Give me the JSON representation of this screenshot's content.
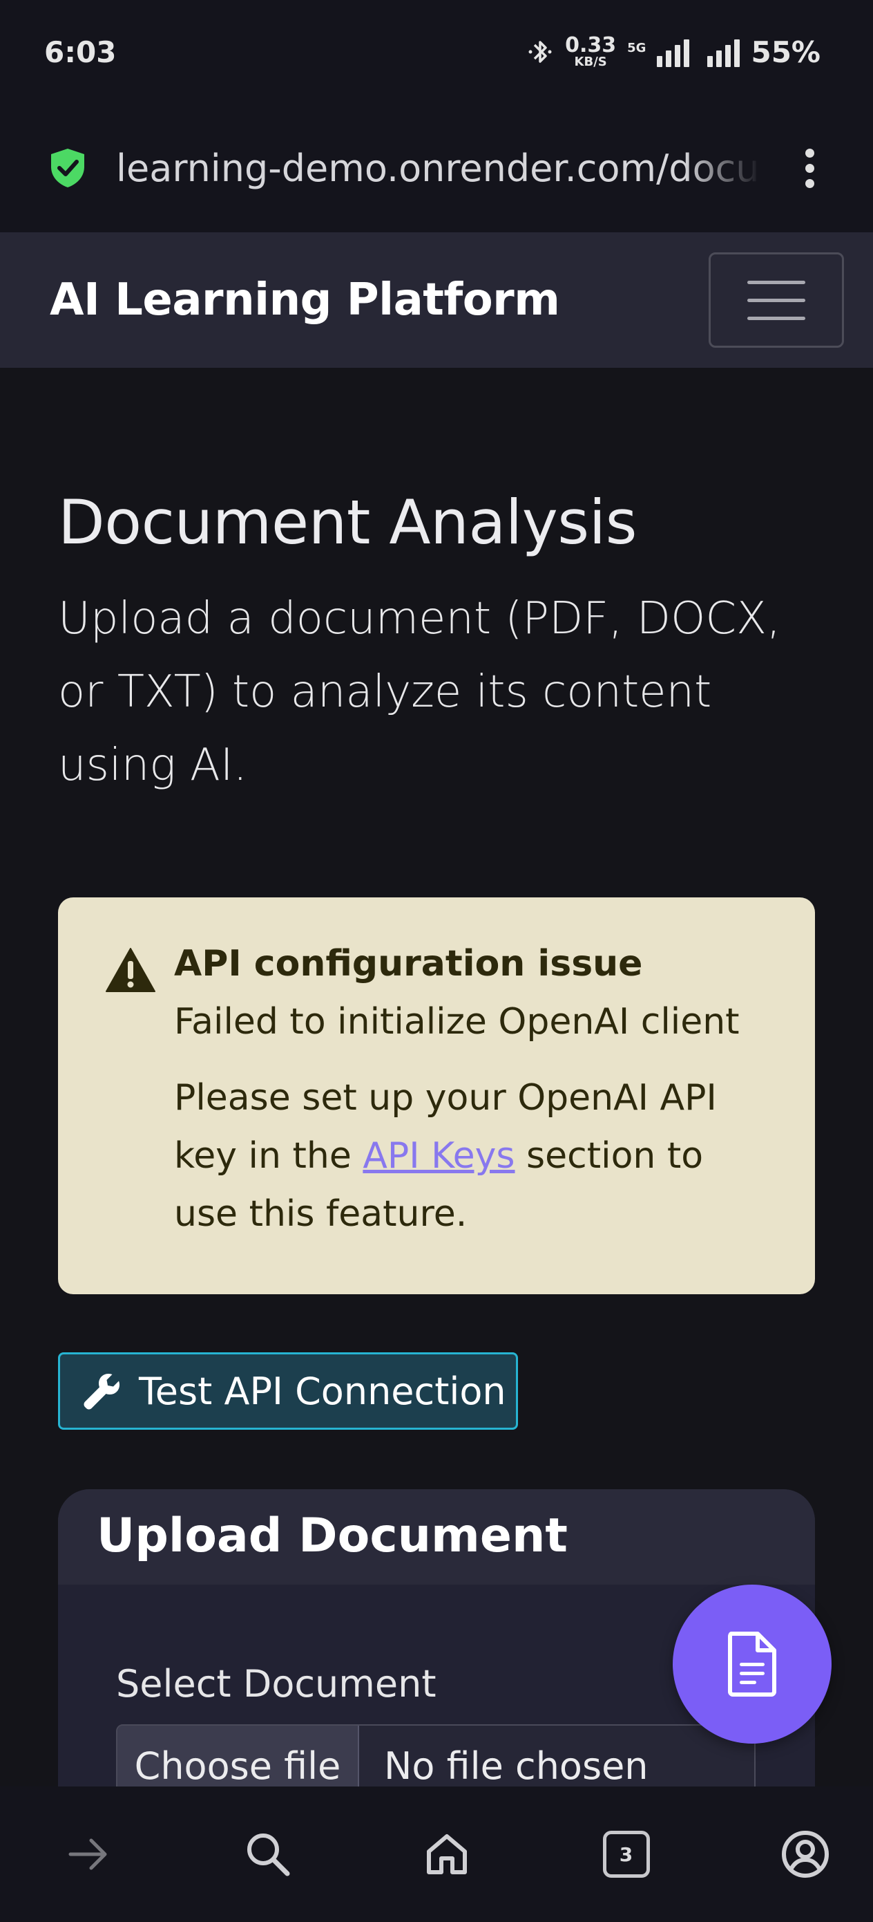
{
  "status": {
    "time": "6:03",
    "speed_value": "0.33",
    "speed_unit": "KB/S",
    "network": "5G",
    "battery": "55%"
  },
  "browser": {
    "url": "learning-demo.onrender.com/documents",
    "tabs_count": "3"
  },
  "navbar": {
    "brand": "AI Learning Platform"
  },
  "page": {
    "title": "Document Analysis",
    "lead": "Upload a document (PDF, DOCX, or TXT) to analyze its content using AI."
  },
  "alert": {
    "title": "API configuration issue",
    "message": "Failed to initialize OpenAI client",
    "help_prefix": "Please set up your OpenAI API key in the ",
    "help_link": "API Keys",
    "help_suffix": " section to use this feature."
  },
  "test_button": {
    "label": "Test API Connection"
  },
  "upload_card": {
    "header": "Upload Document",
    "field_label": "Select Document",
    "choose_button": "Choose file",
    "file_status": "No file chosen"
  },
  "colors": {
    "accent": "#7b5ef6",
    "alert_bg": "#e9e3ca",
    "info_border": "#27b4d2",
    "secure_green": "#4cd964"
  },
  "icons": [
    "bluetooth-icon",
    "signal-icon",
    "secure-shield-icon",
    "menu-icon",
    "warning-icon",
    "wrench-icon",
    "document-icon",
    "forward-icon",
    "search-icon",
    "home-icon",
    "tabs-icon",
    "account-icon"
  ]
}
